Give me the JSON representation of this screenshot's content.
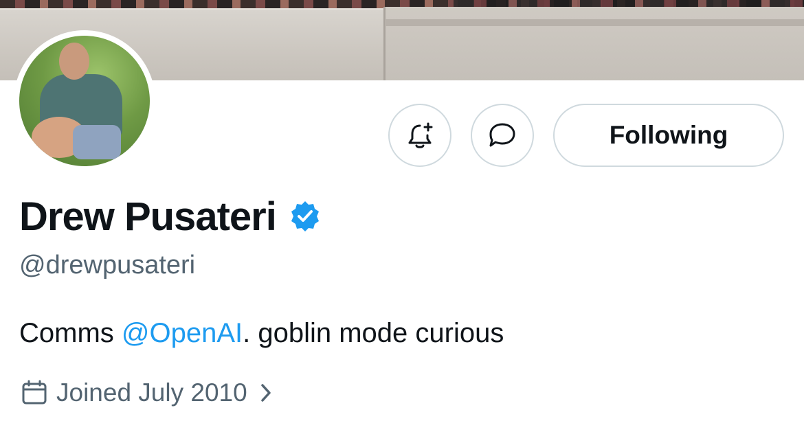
{
  "profile": {
    "display_name": "Drew Pusateri",
    "handle": "@drewpusateri",
    "verified": true,
    "bio": {
      "prefix": "Comms ",
      "mention": "@OpenAI",
      "suffix": ". goblin mode curious"
    },
    "joined": "Joined July 2010"
  },
  "actions": {
    "following_label": "Following"
  },
  "icons": {
    "notify": "bell-plus-icon",
    "message": "message-bubble-icon",
    "verified": "verified-badge-icon",
    "calendar": "calendar-icon",
    "chevron": "chevron-right-icon"
  },
  "colors": {
    "text_primary": "#0f1419",
    "text_secondary": "#536471",
    "accent": "#1d9bf0",
    "border": "#cfd9de"
  }
}
